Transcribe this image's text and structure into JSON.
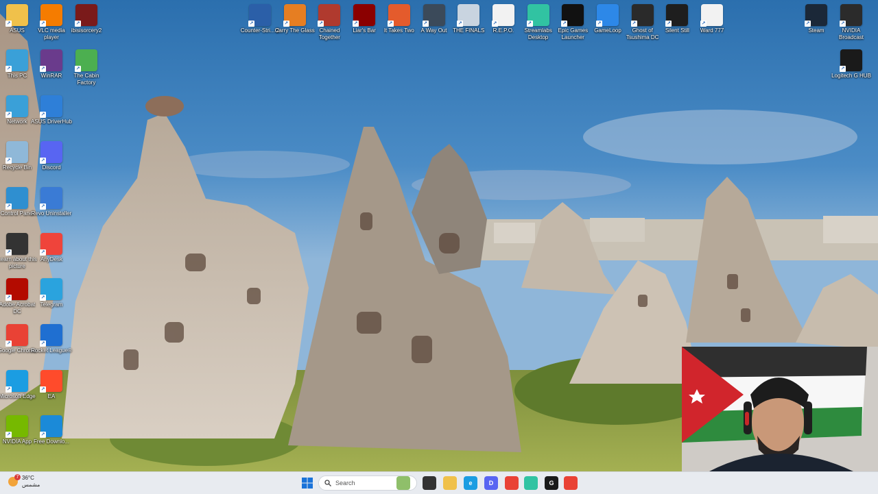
{
  "desktop": {
    "left_icons": [
      {
        "label": "ASUS",
        "icon": "folder-icon",
        "color": "#f0c14b"
      },
      {
        "label": "VLC media player",
        "icon": "vlc-icon",
        "color": "#f57c00"
      },
      {
        "label": "ibisisorcery2",
        "icon": "game-icon",
        "color": "#7a1a1a"
      },
      {
        "label": "This PC",
        "icon": "computer-icon",
        "color": "#3aa0d8"
      },
      {
        "label": "WinRAR",
        "icon": "winrar-icon",
        "color": "#6a3b8c"
      },
      {
        "label": "The Cabin Factory",
        "icon": "frog-icon",
        "color": "#4caf50"
      },
      {
        "label": "Network",
        "icon": "network-icon",
        "color": "#3aa0d8"
      },
      {
        "label": "ASUS DriverHub",
        "icon": "gear-icon",
        "color": "#2e7fd8"
      },
      {
        "label": "Recycle Bin",
        "icon": "recycle-bin-icon",
        "color": "#8fb8d8"
      },
      {
        "label": "Discord",
        "icon": "discord-icon",
        "color": "#5865f2"
      },
      {
        "label": "Control Panel",
        "icon": "control-panel-icon",
        "color": "#2f8fd0"
      },
      {
        "label": "Revo Uninstaller",
        "icon": "revo-icon",
        "color": "#3a7bd5"
      },
      {
        "label": "Learn about this picture",
        "icon": "info-icon",
        "color": "#333333"
      },
      {
        "label": "AnyDesk",
        "icon": "anydesk-icon",
        "color": "#ef443b"
      },
      {
        "label": "Adobe Acrobat DC",
        "icon": "acrobat-icon",
        "color": "#b30b00"
      },
      {
        "label": "Telegram",
        "icon": "telegram-icon",
        "color": "#2aa3de"
      },
      {
        "label": "Google Chrome",
        "icon": "chrome-icon",
        "color": "#e94235"
      },
      {
        "label": "Rocket League®",
        "icon": "rocket-league-icon",
        "color": "#1f6fd1"
      },
      {
        "label": "Microsoft Edge",
        "icon": "edge-icon",
        "color": "#1b9de2"
      },
      {
        "label": "EA",
        "icon": "ea-icon",
        "color": "#ff4b2b"
      },
      {
        "label": "NVIDIA App",
        "icon": "nvidia-icon",
        "color": "#76b900"
      },
      {
        "label": "Free Downlo...",
        "icon": "download-icon",
        "color": "#1b8ad8"
      }
    ],
    "top_icons": [
      {
        "label": "Counter-Stri... 2",
        "icon": "cs2-icon",
        "color": "#2b5fa8"
      },
      {
        "label": "Carry The Glass",
        "icon": "glass-game-icon",
        "color": "#e67e22"
      },
      {
        "label": "Chained Together",
        "icon": "chain-game-icon",
        "color": "#b03a2e"
      },
      {
        "label": "Liar's Bar",
        "icon": "liars-bar-icon",
        "color": "#8b0000"
      },
      {
        "label": "It Takes Two",
        "icon": "it-takes-two-icon",
        "color": "#e45b2c"
      },
      {
        "label": "A Way Out",
        "icon": "a-way-out-icon",
        "color": "#3b4a5a"
      },
      {
        "label": "THE FINALS",
        "icon": "the-finals-icon",
        "color": "#c9d4e0"
      },
      {
        "label": "R.E.P.O.",
        "icon": "file-icon",
        "color": "#f2f2f2"
      },
      {
        "label": "Streamlabs Desktop",
        "icon": "streamlabs-icon",
        "color": "#31c3a2"
      },
      {
        "label": "Epic Games Launcher",
        "icon": "epic-games-icon",
        "color": "#111111"
      },
      {
        "label": "GameLoop",
        "icon": "gameloop-icon",
        "color": "#2d88e8"
      },
      {
        "label": "Ghost of Tsushima DC",
        "icon": "ghost-tsushima-icon",
        "color": "#2a2a2a"
      },
      {
        "label": "Silent Still",
        "icon": "silent-still-icon",
        "color": "#1e1e1e"
      },
      {
        "label": "Ward 777",
        "icon": "file-icon",
        "color": "#f2f2f2"
      }
    ],
    "right_icons": [
      {
        "label": "Steam",
        "icon": "steam-icon",
        "color": "#1b2838"
      },
      {
        "label": "NVIDIA Broadcast",
        "icon": "nvidia-broadcast-icon",
        "color": "#2b2b2b"
      },
      {
        "label": "Logitech G HUB",
        "icon": "logitech-ghub-icon",
        "color": "#1a1a1a"
      }
    ]
  },
  "taskbar": {
    "weather_temp": "36°C",
    "weather_desc": "مشمس",
    "weather_badge": "7",
    "search_placeholder": "Search",
    "apps": [
      {
        "icon": "landscape-app-icon",
        "color": "#8fbf6a",
        "text": ""
      },
      {
        "icon": "task-view-icon",
        "color": "#333333",
        "text": ""
      },
      {
        "icon": "file-explorer-icon",
        "color": "#f0c14b",
        "text": ""
      },
      {
        "icon": "edge-icon",
        "color": "#1b9de2",
        "text": "e"
      },
      {
        "icon": "discord-icon",
        "color": "#5865f2",
        "text": "D"
      },
      {
        "icon": "chrome-icon",
        "color": "#e94235",
        "text": ""
      },
      {
        "icon": "streamlabs-icon",
        "color": "#31c3a2",
        "text": ""
      },
      {
        "icon": "logitech-ghub-icon",
        "color": "#1a1a1a",
        "text": "G"
      },
      {
        "icon": "chrome-icon",
        "color": "#e94235",
        "text": ""
      }
    ]
  }
}
